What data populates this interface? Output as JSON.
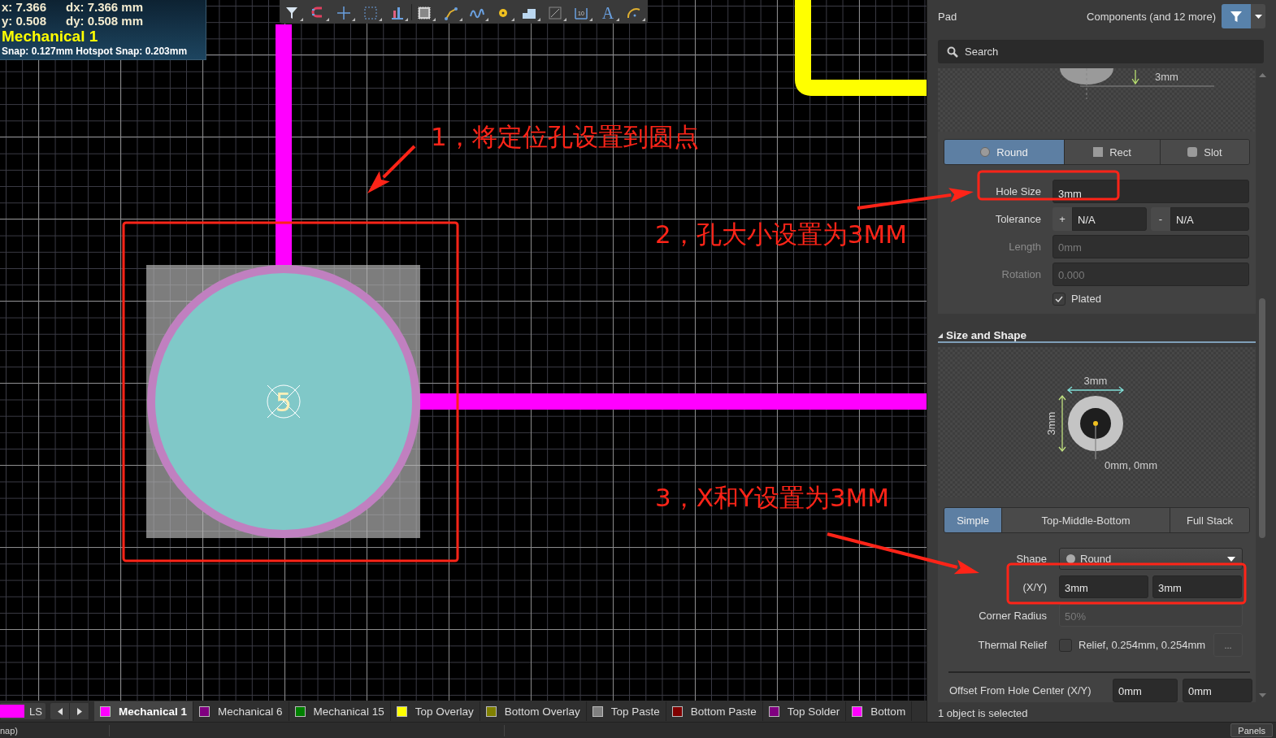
{
  "hud": {
    "x": "x: 7.366",
    "dx": "dx: 7.366 mm",
    "y": "y: 0.508",
    "dy": "dy: 0.508 mm",
    "layer": "Mechanical 1",
    "snap": "Snap: 0.127mm Hotspot Snap: 0.203mm"
  },
  "toolbar": {
    "dimension_icon_text": "10",
    "string_icon_text": "A"
  },
  "canvas": {
    "pad_number": "5"
  },
  "annotations": [
    {
      "text": "1，将定位孔设置到圆点"
    },
    {
      "text": "2，孔大小设置为3MM"
    },
    {
      "text": "3，X和Y设置为3MM"
    }
  ],
  "layer_bar": {
    "current_layer_label": "LS",
    "layers": [
      {
        "name": "Mechanical 1",
        "color": "#ff00ff",
        "selected": true
      },
      {
        "name": "Mechanical 6",
        "color": "#800080",
        "selected": false
      },
      {
        "name": "Mechanical 15",
        "color": "#008000",
        "selected": false
      },
      {
        "name": "Top Overlay",
        "color": "#ffff00",
        "selected": false
      },
      {
        "name": "Bottom Overlay",
        "color": "#808000",
        "selected": false
      },
      {
        "name": "Top Paste",
        "color": "#808080",
        "selected": false
      },
      {
        "name": "Bottom Paste",
        "color": "#800000",
        "selected": false
      },
      {
        "name": "Top Solder",
        "color": "#800080",
        "selected": false
      },
      {
        "name": "Bottom",
        "color": "#ff00ff",
        "selected": false
      }
    ]
  },
  "panel": {
    "object_type": "Pad",
    "filter_label": "Components (and 12 more)",
    "search": {
      "placeholder": "Search"
    },
    "hole_preview": {
      "dimension": "3mm"
    },
    "hole_shapes": [
      {
        "label": "Round",
        "selected": true
      },
      {
        "label": "Rect",
        "selected": false
      },
      {
        "label": "Slot",
        "selected": false
      }
    ],
    "hole_size": {
      "label": "Hole Size",
      "value": "3mm"
    },
    "tolerance": {
      "label": "Tolerance",
      "plus_sign": "+",
      "plus": "N/A",
      "minus_sign": "-",
      "minus": "N/A"
    },
    "length": {
      "label": "Length",
      "value": "0mm",
      "disabled": true
    },
    "rotation": {
      "label": "Rotation",
      "value": "0.000",
      "disabled": true
    },
    "plated": {
      "label": "Plated",
      "checked": true
    },
    "size_and_shape": {
      "title": "Size and Shape",
      "expanded": true,
      "preview": {
        "width": "3mm",
        "height": "3mm",
        "offset": "0mm, 0mm"
      },
      "modes": [
        {
          "label": "Simple",
          "selected": true
        },
        {
          "label": "Top-Middle-Bottom",
          "selected": false
        },
        {
          "label": "Full Stack",
          "selected": false
        }
      ],
      "shape": {
        "label": "Shape",
        "value": "Round"
      },
      "xy": {
        "label": "(X/Y)",
        "x": "3mm",
        "y": "3mm"
      },
      "corner_radius": {
        "label": "Corner Radius",
        "value": "50%",
        "disabled": true
      },
      "thermal_relief": {
        "label": "Thermal Relief",
        "checked": false,
        "value": "Relief, 0.254mm, 0.254mm",
        "more": "..."
      },
      "offset": {
        "label": "Offset From Hole Center (X/Y)",
        "x": "0mm",
        "y": "0mm"
      }
    },
    "selection_status": "1 object is selected"
  },
  "status_bar": {
    "left_text": "nap)",
    "panels_button": "Panels"
  }
}
